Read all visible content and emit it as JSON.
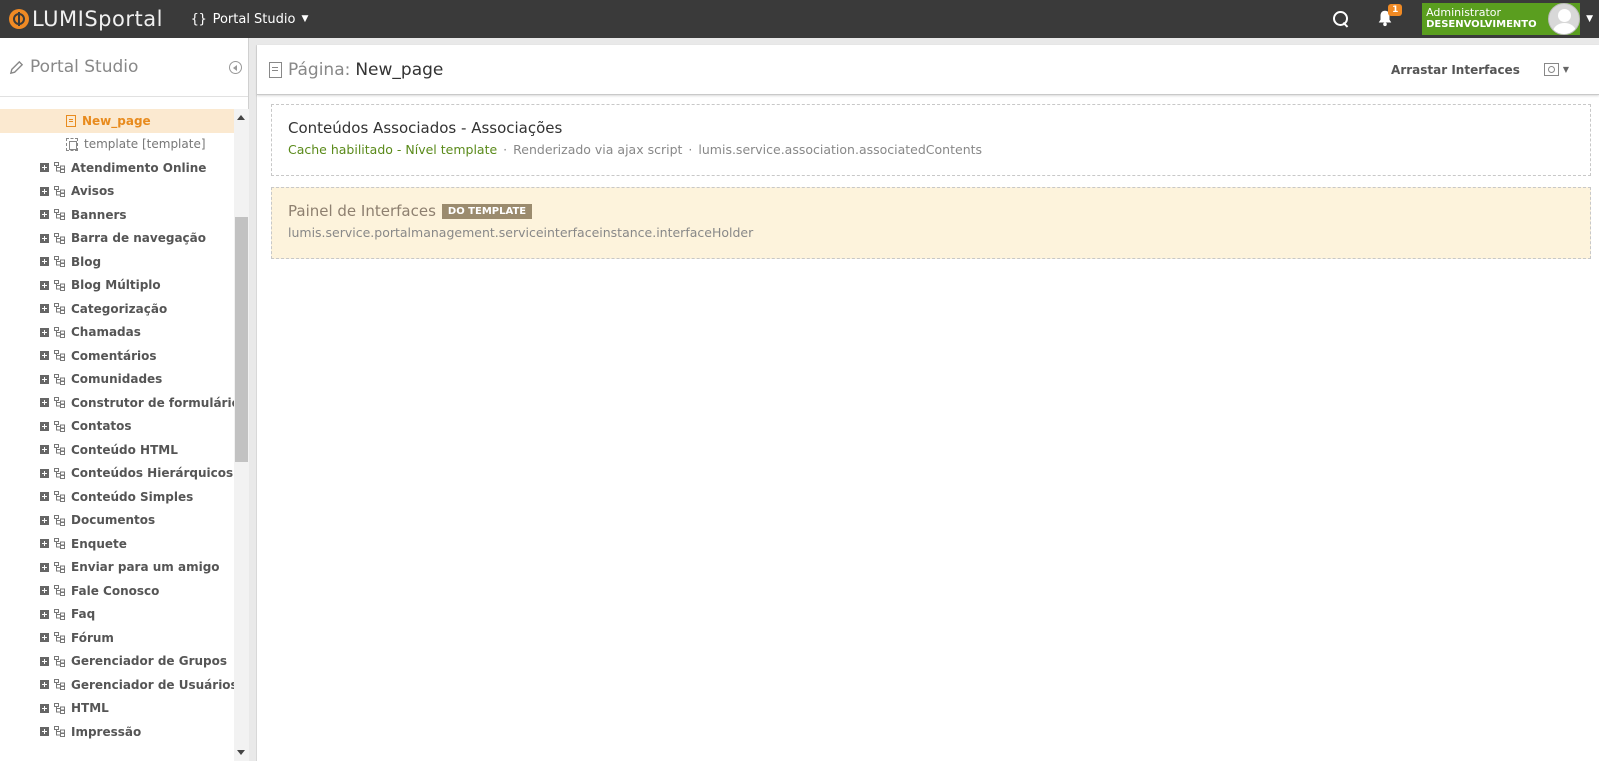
{
  "topbar": {
    "logo_text": "LUMISportal",
    "studio": "Portal Studio",
    "notification_count": "1",
    "user_name": "Administrator",
    "environment": "DESENVOLVIMENTO"
  },
  "sidebar": {
    "title": "Portal Studio",
    "tree": {
      "active_page": "New_page",
      "template": "template [template]",
      "items": [
        {
          "label": "Atendimento Online"
        },
        {
          "label": "Avisos"
        },
        {
          "label": "Banners"
        },
        {
          "label": "Barra de navegação"
        },
        {
          "label": "Blog"
        },
        {
          "label": "Blog Múltiplo"
        },
        {
          "label": "Categorização"
        },
        {
          "label": "Chamadas"
        },
        {
          "label": "Comentários"
        },
        {
          "label": "Comunidades"
        },
        {
          "label": "Construtor de formulários"
        },
        {
          "label": "Contatos"
        },
        {
          "label": "Conteúdo HTML"
        },
        {
          "label": "Conteúdos Hierárquicos"
        },
        {
          "label": "Conteúdo Simples"
        },
        {
          "label": "Documentos"
        },
        {
          "label": "Enquete"
        },
        {
          "label": "Enviar para um amigo"
        },
        {
          "label": "Fale Conosco"
        },
        {
          "label": "Faq"
        },
        {
          "label": "Fórum"
        },
        {
          "label": "Gerenciador de Grupos"
        },
        {
          "label": "Gerenciador de Usuários"
        },
        {
          "label": "HTML"
        },
        {
          "label": "Impressão"
        }
      ]
    }
  },
  "main": {
    "page_label": "Página:",
    "page_name": "New_page",
    "drag_label": "Arrastar Interfaces",
    "cards": [
      {
        "title": "Conteúdos Associados - Associações",
        "cache": "Cache habilitado - Nível template",
        "render": "Renderizado via ajax script",
        "service": "lumis.service.association.associatedContents"
      },
      {
        "title": "Painel de Interfaces",
        "badge": "DO TEMPLATE",
        "service": "lumis.service.portalmanagement.serviceinterfaceinstance.interfaceHolder"
      }
    ]
  },
  "colors": {
    "topbar": "#3a3a3a",
    "accent": "#f08a24",
    "user_bg": "#5a9e1f",
    "active_row": "#fbe9d0",
    "template_card": "#fdf3dc"
  }
}
